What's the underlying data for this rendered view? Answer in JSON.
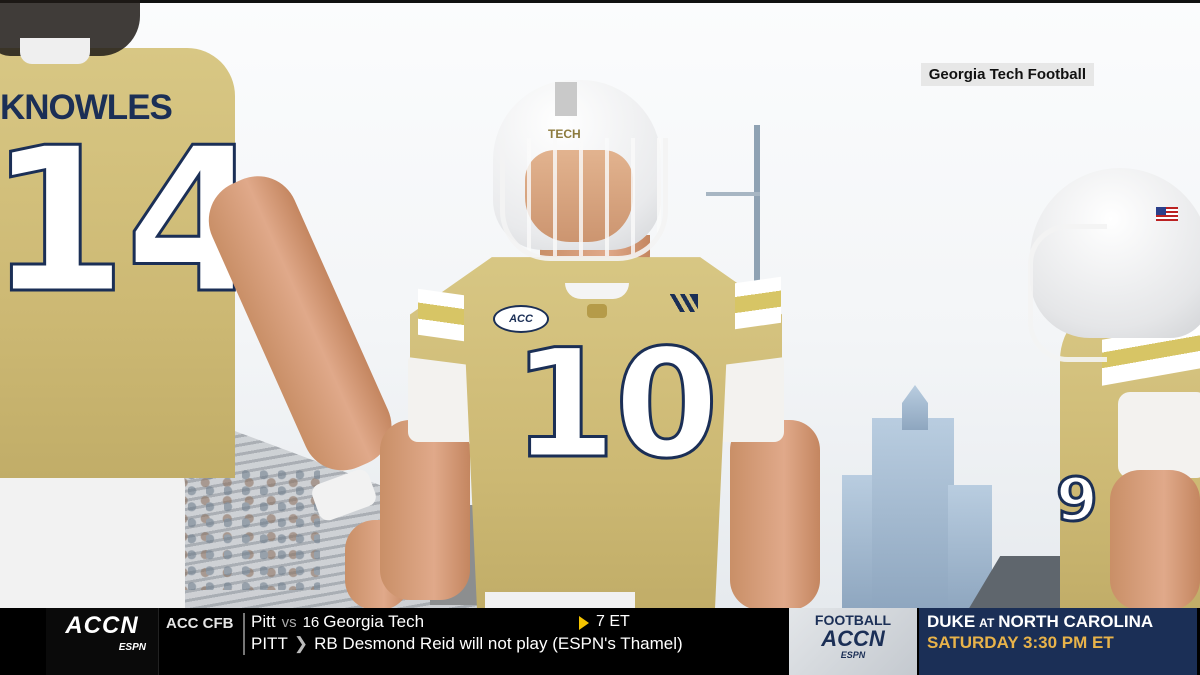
{
  "broadcast": {
    "bug_label": "Georgia Tech Football",
    "players": {
      "left": {
        "name": "KNOWLES",
        "number": "14"
      },
      "center": {
        "number": "10",
        "helmet_text": "TECH",
        "patch": "ACC"
      },
      "right": {
        "number": "9"
      }
    }
  },
  "ticker": {
    "network": "ACCN",
    "network_sub": "ESPN",
    "section": "ACC CFB",
    "away_team": "Pitt",
    "vs": "vs",
    "home_rank": "16",
    "home_team": "Georgia Tech",
    "time": "7 ET",
    "headline_team": "PITT",
    "headline": "RB Desmond Reid will not play (ESPN's Thamel)"
  },
  "promo": {
    "brand_line1": "FOOTBALL",
    "brand_line2": "ACCN",
    "brand_line3": "ESPN",
    "team_a": "DUKE",
    "at": "AT",
    "team_b": "NORTH CAROLINA",
    "when": "SATURDAY 3:30 PM ET"
  },
  "colors": {
    "navy": "#1b2f56",
    "gold": "#cdb974",
    "accent_yellow": "#f5c400",
    "promo_orange": "#e8b34a"
  }
}
